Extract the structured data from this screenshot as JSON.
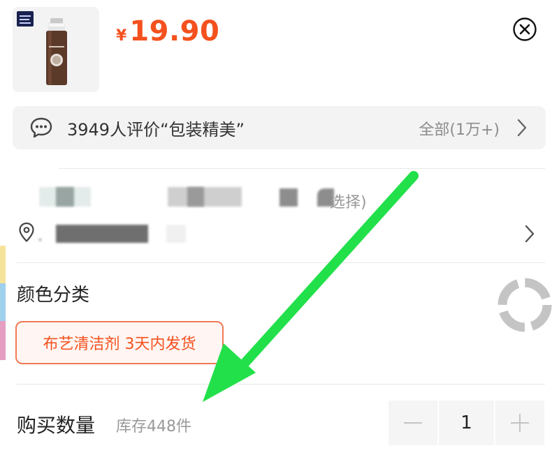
{
  "product": {
    "currency": "¥",
    "price": "19.90",
    "thumbnail_icon": "product-bottle-image"
  },
  "reviews": {
    "summary": "3949人评价“包装精美”",
    "all_label": "全部(1万+)",
    "icon": "chat-bubble-icon"
  },
  "selection": {
    "hint": "选择)"
  },
  "location": {
    "icon": "location-pin-icon"
  },
  "color_category": {
    "title": "颜色分类",
    "options": [
      "布艺清洁剂 3天内发货"
    ]
  },
  "quantity": {
    "title": "购买数量",
    "stock": "库存448件",
    "value": "1",
    "decrease_icon": "minus-icon",
    "increase_icon": "plus-icon"
  },
  "colors": {
    "price": "#f4511e",
    "chip_border": "#f07a55",
    "chip_bg": "#fff6f3",
    "arrow": "#22e04a"
  }
}
